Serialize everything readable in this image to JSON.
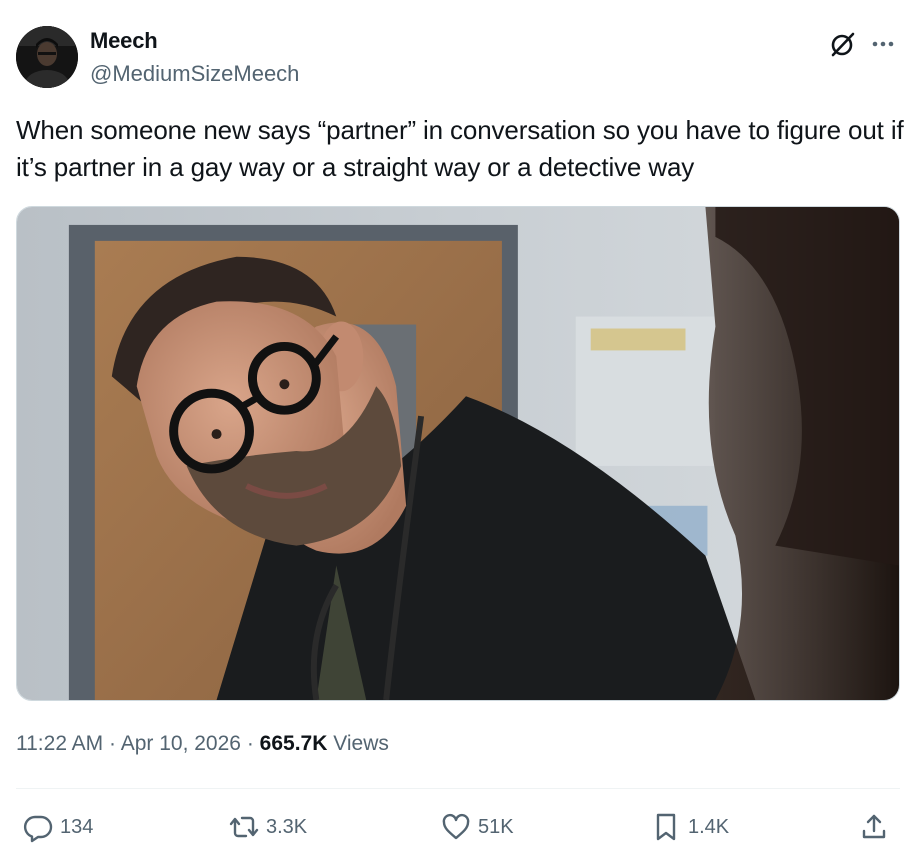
{
  "author": {
    "display_name": "Meech",
    "handle": "@MediumSizeMeech",
    "avatar_icon": "user-avatar"
  },
  "tweet": {
    "text": "When someone new says “partner” in conversation so you have to figure out if it’s partner in a gay way or a straight way or a detective way"
  },
  "media": {
    "type": "photo"
  },
  "meta": {
    "time": "11:22 AM",
    "separator": "·",
    "date": "Apr 10, 2026",
    "views_count": "665.7K",
    "views_label": "Views"
  },
  "actions": {
    "replies": "134",
    "reposts": "3.3K",
    "likes": "51K",
    "bookmarks": "1.4K"
  },
  "icons": {
    "grok": "grok-icon",
    "more": "more-icon",
    "reply": "reply-icon",
    "repost": "repost-icon",
    "like": "heart-icon",
    "bookmark": "bookmark-icon",
    "share": "share-icon"
  },
  "colors": {
    "text_primary": "#0f1419",
    "text_secondary": "#536471",
    "border": "#cfd9de",
    "divider": "#eff3f4"
  }
}
